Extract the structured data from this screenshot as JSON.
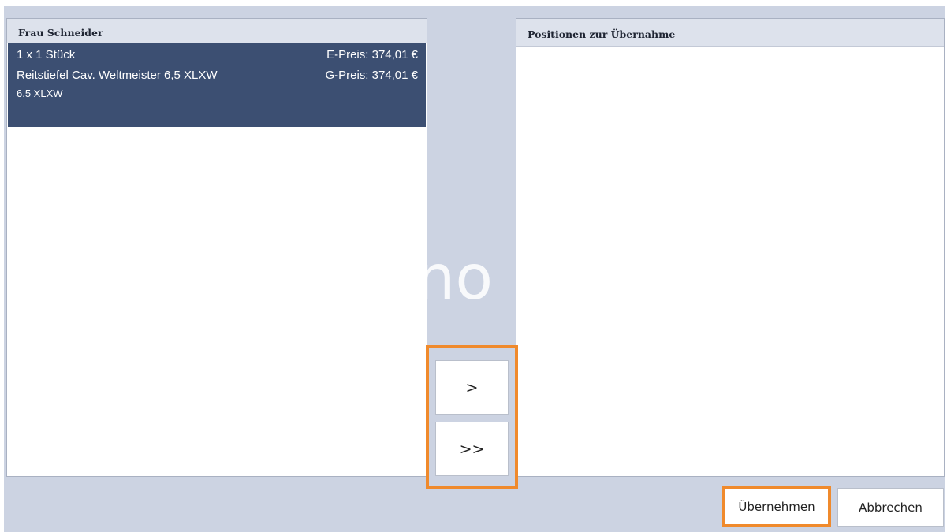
{
  "left_panel": {
    "title": "Frau Schneider",
    "items": [
      {
        "quantity": "1 x 1 Stück",
        "name": "Reitstiefel Cav. Weltmeister 6,5 XLXW",
        "size": "6.5 XLXW",
        "unit_price": "E-Preis: 374,01 €",
        "total_price": "G-Preis: 374,01 €",
        "selected": true
      }
    ]
  },
  "right_panel": {
    "title": "Positionen zur Übernahme"
  },
  "transfer": {
    "move_one_label": ">",
    "move_all_label": ">>"
  },
  "footer": {
    "accept_label": "Übernehmen",
    "cancel_label": "Abbrechen"
  },
  "watermark": "no",
  "colors": {
    "highlight": "#f08a2c",
    "selected_row": "#3c4f72",
    "window_bg": "#ccd3e2"
  }
}
